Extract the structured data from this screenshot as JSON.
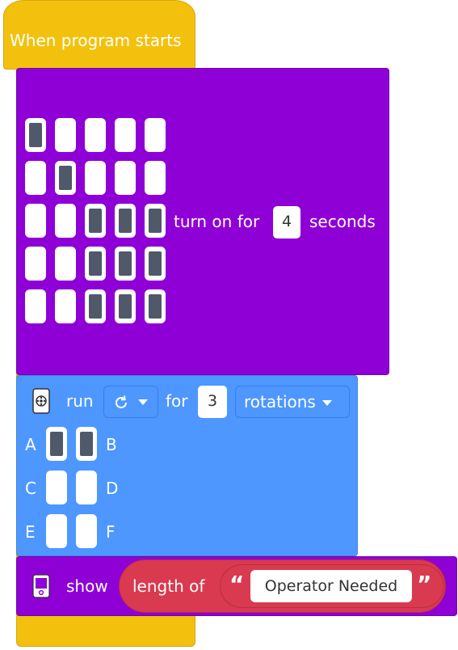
{
  "hat": {
    "title": "When program starts"
  },
  "matrix_block": {
    "grid": [
      [
        1,
        0,
        0,
        0,
        0
      ],
      [
        0,
        1,
        0,
        0,
        0
      ],
      [
        0,
        0,
        1,
        1,
        1
      ],
      [
        0,
        0,
        1,
        1,
        1
      ],
      [
        0,
        0,
        1,
        1,
        1
      ]
    ],
    "turn_on_label": "turn on for",
    "seconds_value": "4",
    "seconds_label": "seconds"
  },
  "motor_block": {
    "run_label": "run",
    "direction_icon": "rotate-clockwise-icon",
    "for_label": "for",
    "amount_value": "3",
    "unit_value": "rotations",
    "ports": [
      {
        "left": "A",
        "right": "B",
        "left_on": true,
        "right_on": true
      },
      {
        "left": "C",
        "right": "D",
        "left_on": false,
        "right_on": false
      },
      {
        "left": "E",
        "right": "F",
        "left_on": false,
        "right_on": false
      }
    ]
  },
  "show_block": {
    "show_label": "show",
    "length_of_label": "length of",
    "open_quote": "“",
    "close_quote": "”",
    "text_value": "Operator Needed"
  },
  "colors": {
    "event_yellow": "#f3c10d",
    "display_purple": "#8f00d6",
    "motor_blue": "#4d97ff",
    "operator_red": "#d93a4f"
  }
}
